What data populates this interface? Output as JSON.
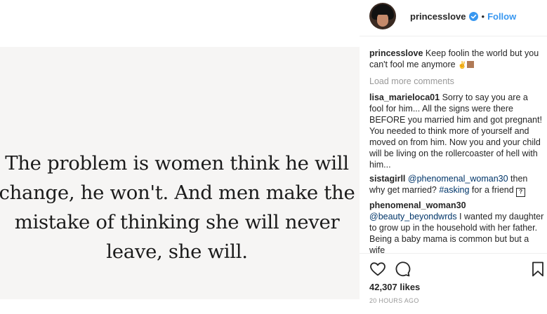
{
  "post": {
    "quote_lines": [
      "The problem is women think he will",
      "change, he won't. And men make the",
      "mistake of thinking she will never",
      "leave, she will."
    ]
  },
  "header": {
    "username": "princesslove",
    "separator": "•",
    "follow_label": "Follow",
    "verified_color": "#3897f0"
  },
  "caption": {
    "user": "princesslove",
    "text": "Keep foolin the world but you can't fool me anymore"
  },
  "load_more_label": "Load more comments",
  "comments": [
    {
      "user": "lisa_marieloca01",
      "text": "Sorry to say you are a fool for him... All the signs were there BEFORE you married him and got pregnant! You needed to think more of yourself and moved on from him. Now you and your child will be living on the rollercoaster of hell with him..."
    },
    {
      "user": "sistagirll",
      "mention": "@phenomenal_woman30",
      "text_1": " then why get married? ",
      "hashtag": "#asking",
      "text_2": " for a friend",
      "glyph": "?"
    },
    {
      "user": "phenomenal_woman30",
      "mention": "@beauty_beyondwrds",
      "text": " I wanted my daughter to grow up in the household with her father. Being a baby mama is common but but a wife"
    }
  ],
  "likes": "42,307 likes",
  "timestamp": "20 HOURS AGO",
  "icons": [
    "heart-icon",
    "comment-icon",
    "bookmark-icon",
    "verified-badge-icon"
  ]
}
